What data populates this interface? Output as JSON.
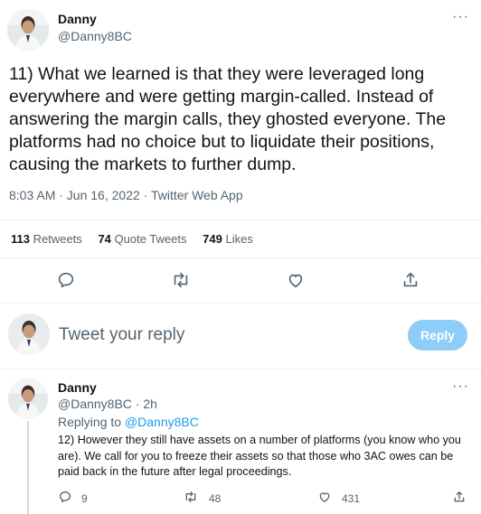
{
  "main_tweet": {
    "name": "Danny",
    "handle": "@Danny8BC",
    "more": "···",
    "text": "11) What we learned is that they were leveraged long everywhere and were getting margin-called. Instead of answering the margin calls, they ghosted everyone. The platforms had no choice but to liquidate their positions, causing the markets to further dump.",
    "meta": "8:03 AM · Jun 16, 2022 · Twitter Web App",
    "stats": [
      {
        "count": "113",
        "label": "Retweets"
      },
      {
        "count": "74",
        "label": "Quote Tweets"
      },
      {
        "count": "749",
        "label": "Likes"
      }
    ]
  },
  "actions": [
    {
      "icon": "reply-icon"
    },
    {
      "icon": "retweet-icon"
    },
    {
      "icon": "like-icon"
    },
    {
      "icon": "share-icon"
    }
  ],
  "composer": {
    "placeholder": "Tweet your reply",
    "button": "Reply"
  },
  "reply_tweet": {
    "name": "Danny",
    "handle": "@Danny8BC",
    "time": "2h",
    "more": "···",
    "replying_prefix": "Replying to",
    "replying_to": "@Danny8BC",
    "text": "12) However they still have assets on a number of platforms (you know who you are). We call for you to freeze their assets so that those who 3AC owes can be paid back in the future after legal proceedings.",
    "counts": {
      "replies": "9",
      "retweets": "48",
      "likes": "431"
    }
  },
  "colors": {
    "accent": "#1d9bf0",
    "reply_button": "#8ecdf8",
    "secondary_text": "#536471",
    "divider": "#eff3f4"
  }
}
